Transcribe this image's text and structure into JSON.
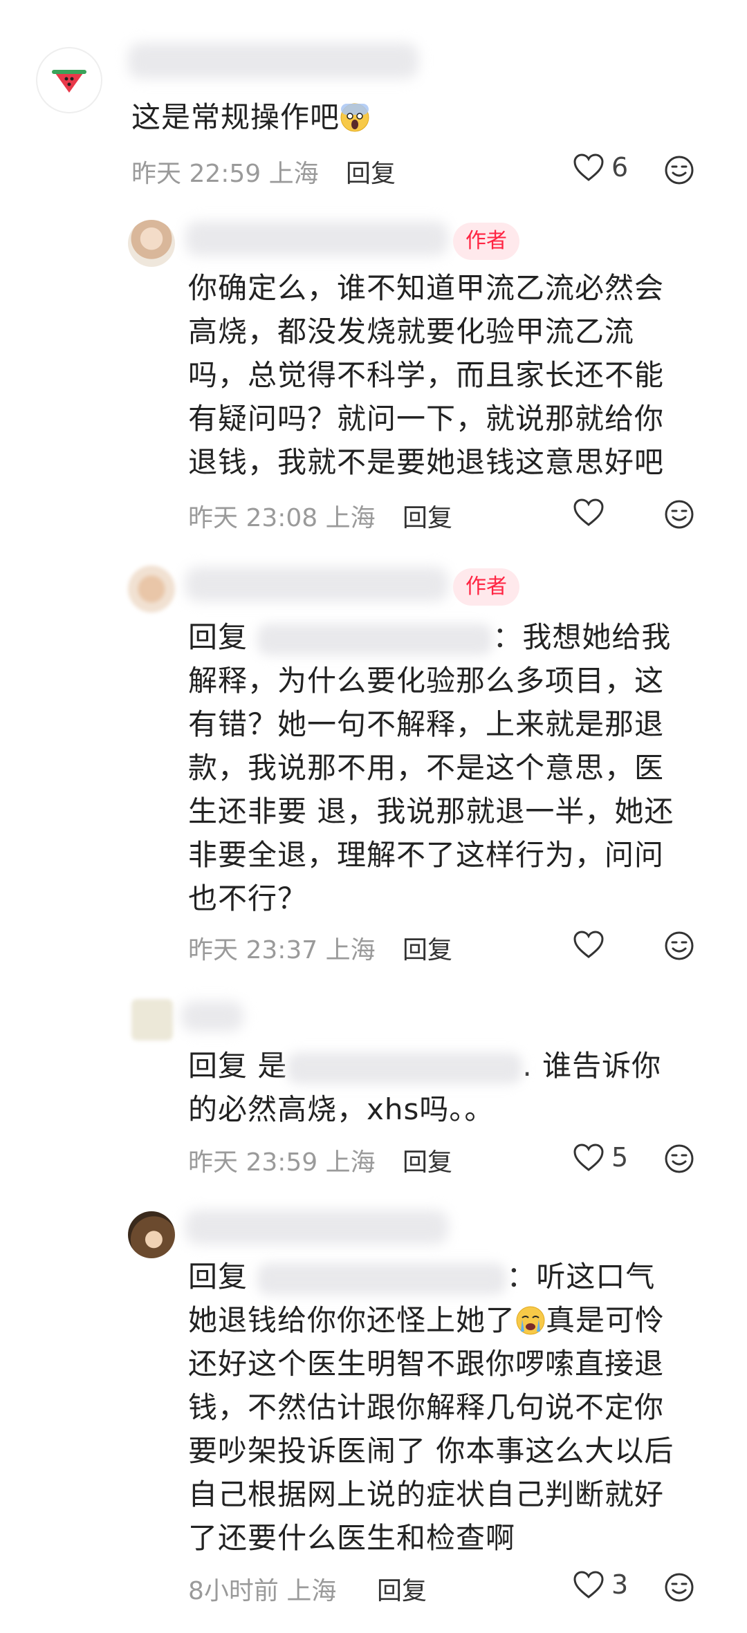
{
  "comments": [
    {
      "text_before_emoji": "这是常规操作吧",
      "time": "昨天 22:59",
      "location": "上海",
      "reply_label": "回复",
      "likes": "6"
    },
    {
      "author_tag": "作者",
      "lines": [
        "你确定么，谁不知道甲流乙流必然会",
        "高烧，都没发烧就要化验甲流乙流",
        "吗，总觉得不科学，而且家长还不能",
        "有疑问吗？就问一下，就说那就给你",
        "退钱，我就不是要她退钱这意思好吧"
      ],
      "time": "昨天 23:08",
      "location": "上海",
      "reply_label": "回复"
    },
    {
      "author_tag": "作者",
      "reply_prefix": "回复",
      "first_line_tail": "：我想她给我",
      "lines": [
        "解释，为什么要化验那么多项目，这",
        "有错？她一句不解释，上来就是那退",
        "款，我说那不用，不是这个意思，医",
        "生还非要 退，我说那就退一半，她还",
        "非要全退，理解不了这样行为，问问",
        "也不行？"
      ],
      "time": "昨天 23:37",
      "location": "上海",
      "reply_label": "回复"
    },
    {
      "reply_prefix": "回复",
      "mention_start": "是",
      "first_line_tail": ". 谁告诉你",
      "lines": [
        "的必然高烧，xhs吗。。"
      ],
      "time": "昨天 23:59",
      "location": "上海",
      "reply_label": "回复",
      "likes": "5"
    },
    {
      "reply_prefix": "回复",
      "first_line_tail": "：听这口气",
      "line2_before_emoji": "她退钱给你你还怪上她了",
      "line2_after_emoji": "真是可怜",
      "lines": [
        "还好这个医生明智不跟你啰嗦直接退",
        "钱，不然估计跟你解释几句说不定你",
        "要吵架投诉医闹了 你本事这么大以后",
        "自己根据网上说的症状自己判断就好",
        "了还要什么医生和检查啊"
      ],
      "time": "8小时前",
      "location": "上海",
      "reply_label": "回复",
      "likes": "3"
    }
  ],
  "icons": {
    "like": "heart-outline-icon",
    "emoji": "smile-face-icon",
    "avatar1": "watermelon-icon",
    "scared_emoji": "scream-face-emoji",
    "crying_emoji": "crying-face-emoji"
  },
  "colors": {
    "author_tag_bg": "#ffe9ec",
    "author_tag_text": "#ff2442",
    "meta": "#9a9a9a"
  }
}
